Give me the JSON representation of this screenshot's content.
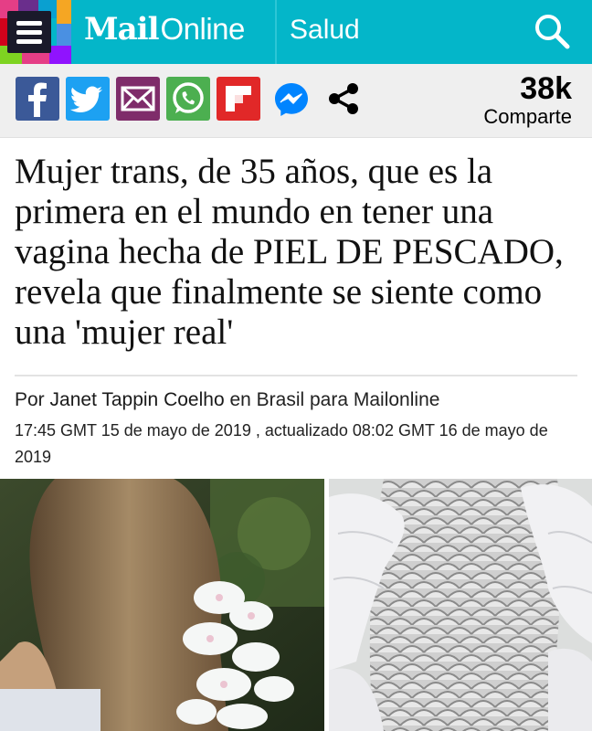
{
  "header": {
    "logo_mail": "Mail",
    "logo_online": "Online",
    "section": "Salud",
    "menu_icon": "hamburger-menu-icon",
    "search_icon": "search-icon",
    "brand_color": "#04b6c9"
  },
  "share": {
    "buttons": [
      {
        "icon": "facebook-icon",
        "color": "#3b5998"
      },
      {
        "icon": "twitter-icon",
        "color": "#1da1f2"
      },
      {
        "icon": "email-icon",
        "color": "#7f2c6a"
      },
      {
        "icon": "whatsapp-icon",
        "color": "#4caf50"
      },
      {
        "icon": "flipboard-icon",
        "color": "#e12828"
      },
      {
        "icon": "messenger-icon",
        "color": "#0084ff"
      },
      {
        "icon": "share-icon",
        "color": "#000000"
      }
    ],
    "count": "38k",
    "count_label": "Comparte"
  },
  "article": {
    "headline": "Mujer trans, de 35 años, que es la primera en el mundo en tener una vagina hecha de PIEL DE PESCADO, revela que finalmente se siente como una 'mujer real'",
    "byline_prefix": "Por",
    "author": "Janet Tappin Coelho",
    "byline_suffix": "en Brasil para Mailonline",
    "dateline": "17:45 GMT 15 de mayo de 2019 , actualizado 08:02 GMT 16 de mayo de 2019"
  },
  "image": {
    "left_description": "woman-photo",
    "right_description": "fish-skin-photo"
  }
}
